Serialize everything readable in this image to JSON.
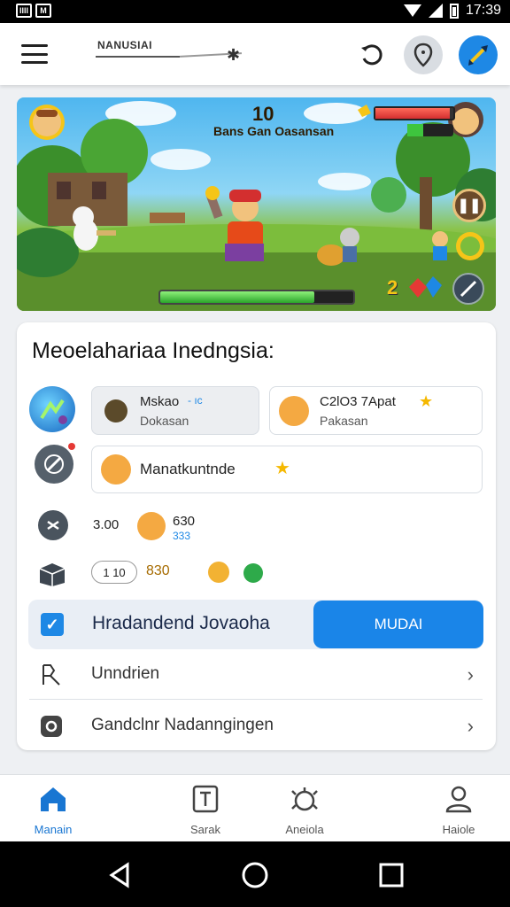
{
  "status_bar": {
    "time": "17:39",
    "left_icons": [
      "IIII",
      "M"
    ]
  },
  "app_bar": {
    "brand": "NANUSIAI",
    "icons": [
      "menu-icon",
      "refresh-icon",
      "location-icon",
      "avatar-icon"
    ]
  },
  "game": {
    "score": "10",
    "subtitle": "Bans Gan Oasansan",
    "level": "2",
    "hp_fraction": 0.95,
    "mp_fraction": 0.35,
    "progress_fraction": 0.8
  },
  "card": {
    "title": "Meoelahariaa Inedngsia:",
    "chip1": {
      "title": "Mskao",
      "tag": "- ıc",
      "sub": "Dokasan"
    },
    "chip2": {
      "title": "C2lO3 7Apat",
      "sub": "Pakasan"
    },
    "chip3": {
      "title": "Manatkuntnde"
    },
    "row4": {
      "value1": "3.00",
      "value2": "630",
      "value2_sub": "333"
    },
    "row5": {
      "pill1": "1",
      "pill2": "10",
      "coins": "830"
    },
    "highlight": {
      "label": "Hradandend Jovaoha",
      "button": "MUDAI"
    },
    "list": [
      {
        "label": "Unndrien"
      },
      {
        "label": "Gandclnr Nadanngingen"
      }
    ]
  },
  "bottom_nav": [
    {
      "label": "Manain",
      "icon": "home-icon",
      "active": true
    },
    {
      "label": "Sarak",
      "icon": "text-icon",
      "active": false
    },
    {
      "label": "Aneiola",
      "icon": "bug-icon",
      "active": false
    },
    {
      "label": "Haiole",
      "icon": "profile-icon",
      "active": false
    }
  ],
  "colors": {
    "accent": "#1a85e8",
    "active_nav": "#1976d2",
    "hp": "#d32f2f",
    "mp": "#3ec53e"
  }
}
